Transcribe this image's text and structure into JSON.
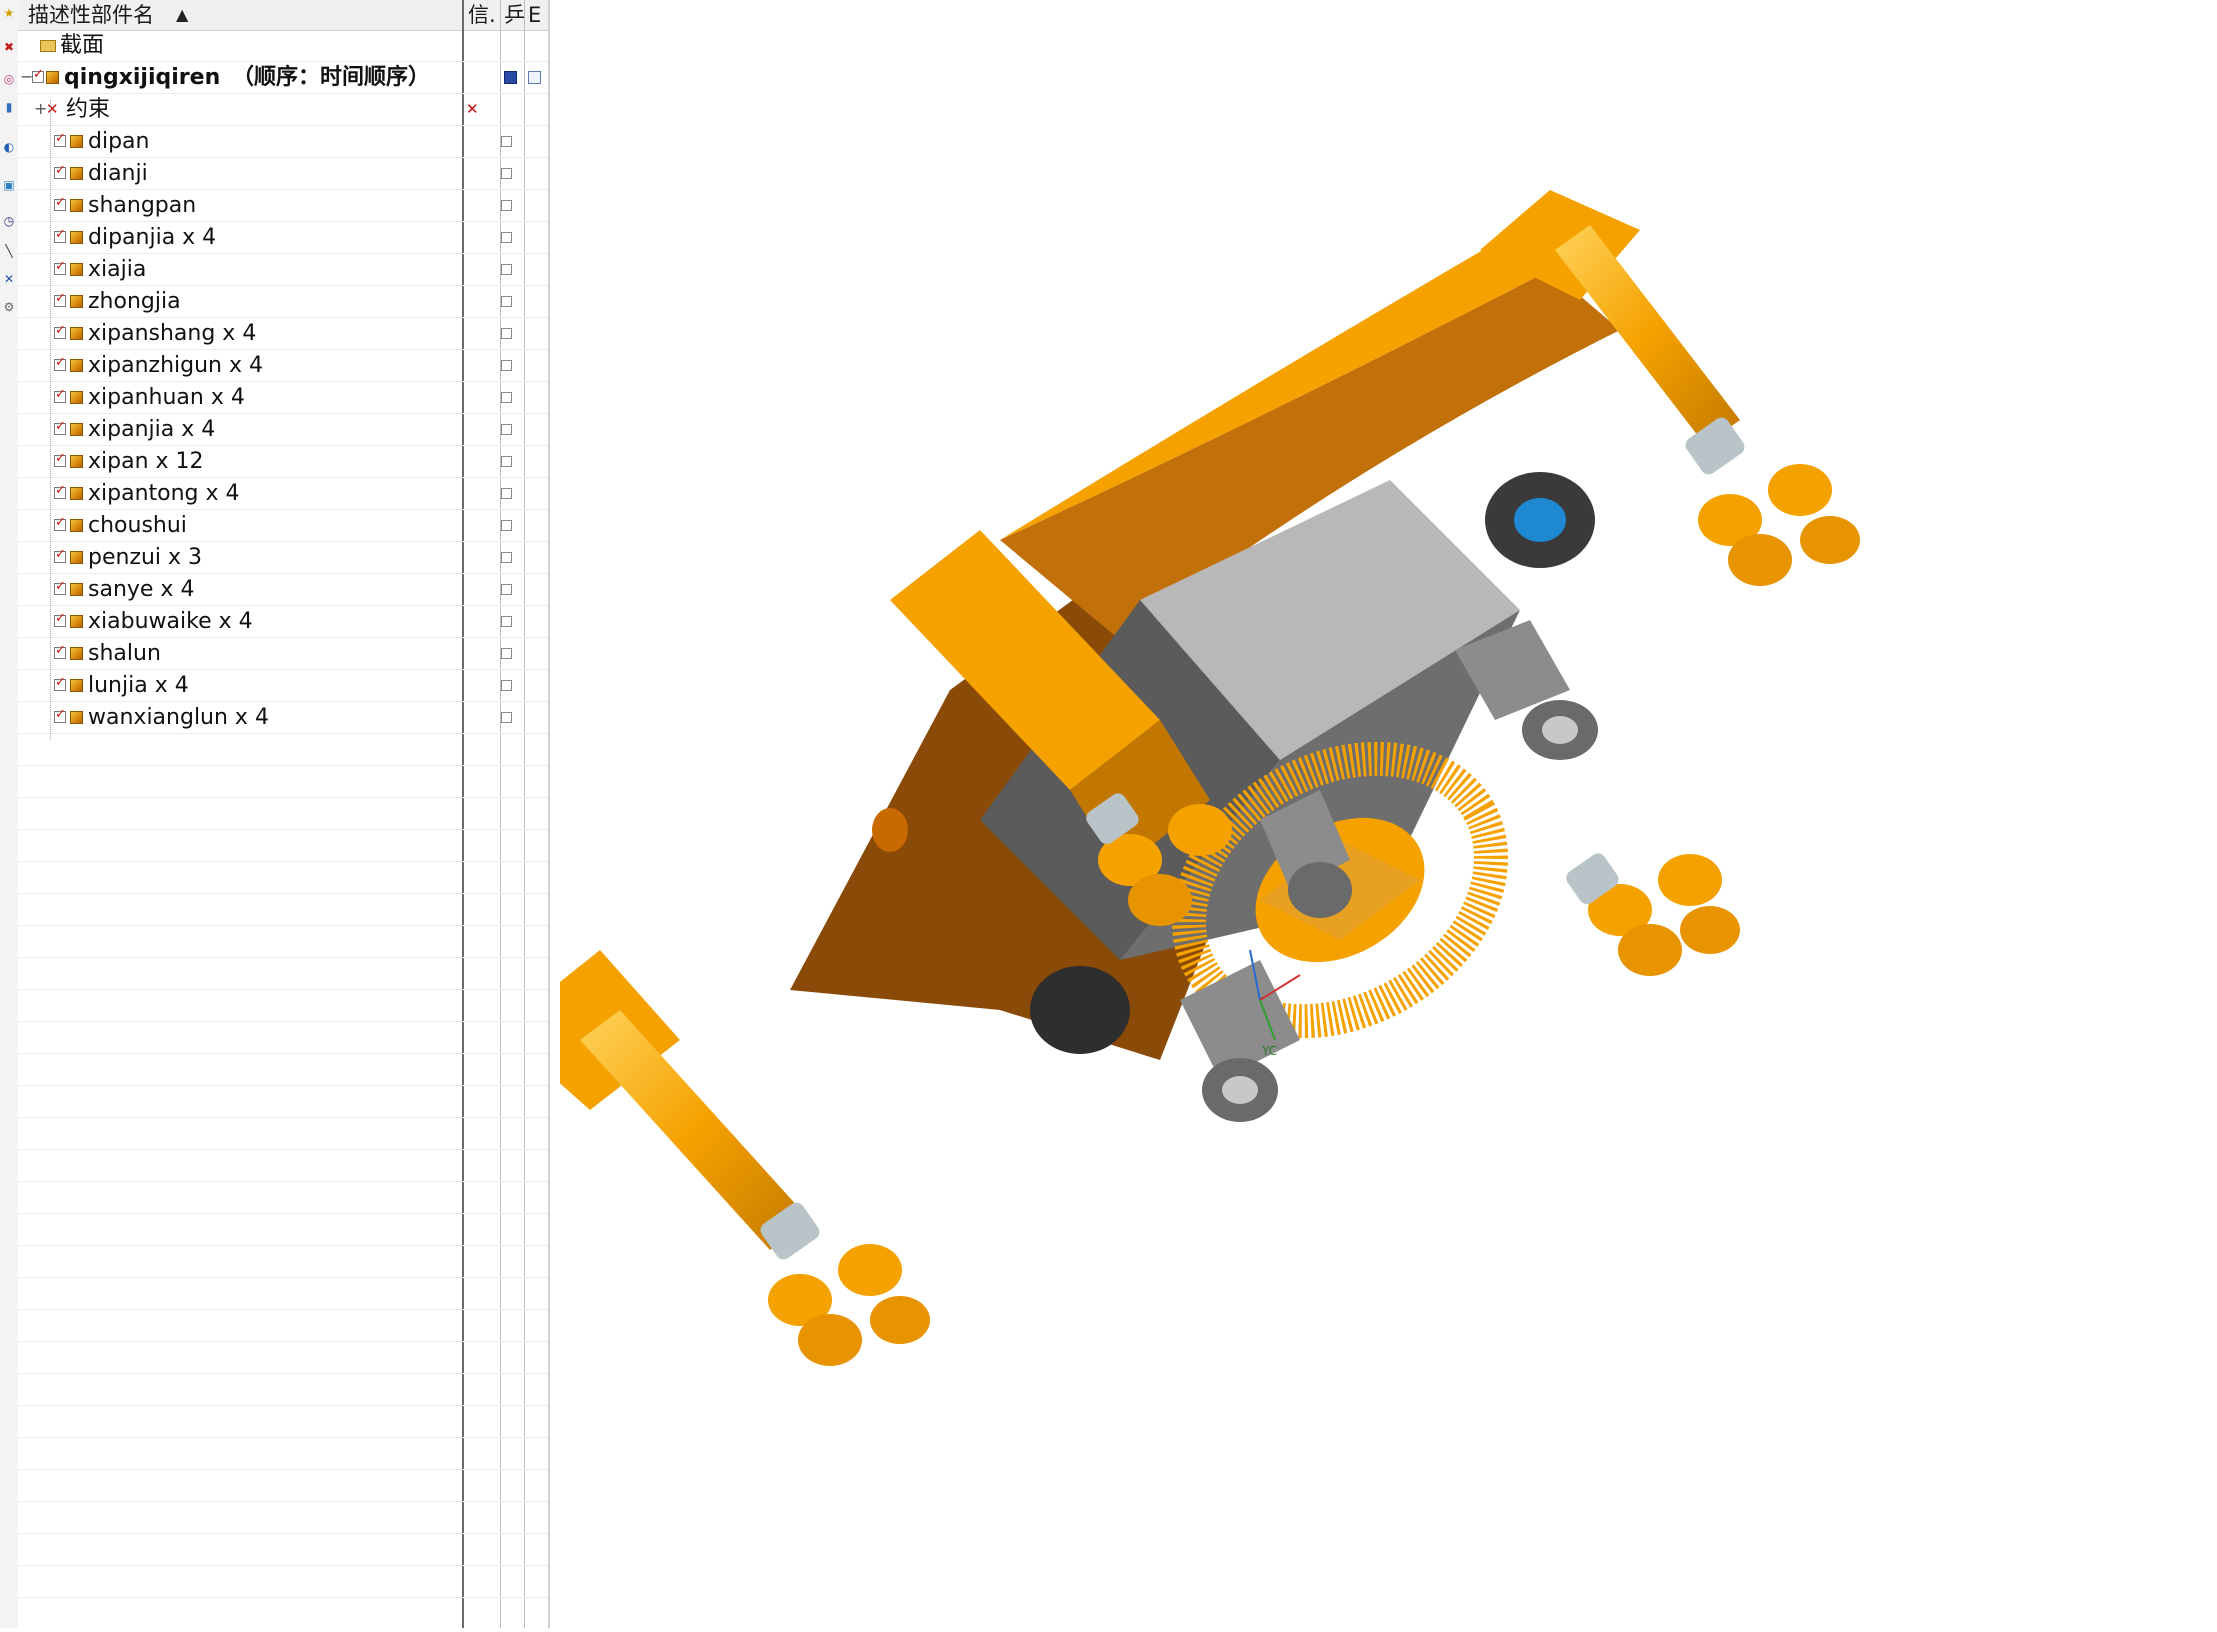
{
  "navigator": {
    "header": {
      "col_name": "描述性部件名",
      "sort_icon": "sort-up-icon",
      "col_info": "信.",
      "col_2": "乒",
      "col_3": "E"
    },
    "section_label": "截面",
    "assembly": {
      "name": "qingxijiqiren",
      "order": "（顺序：时间顺序）"
    },
    "constraints_label": "约束",
    "parts": [
      "dipan",
      "dianji",
      "shangpan",
      "dipanjia x 4",
      "xiajia",
      "zhongjia",
      "xipanshang x 4",
      "xipanzhigun x 4",
      "xipanhuan x 4",
      "xipanjia x 4",
      "xipan x 12",
      "xipantong x 4",
      "choushui",
      "penzui x 3",
      "sanye x 4",
      "xiabuwaike x 4",
      "shalun",
      "lunjia x 4",
      "wanxianglun x 4"
    ]
  },
  "viewport": {
    "model_colors": {
      "orange": "#f5a200",
      "orange_dark": "#8a4a08",
      "gray": "#6e6e6e",
      "gray_light": "#b8b8b8"
    },
    "axis_label": "YC"
  }
}
